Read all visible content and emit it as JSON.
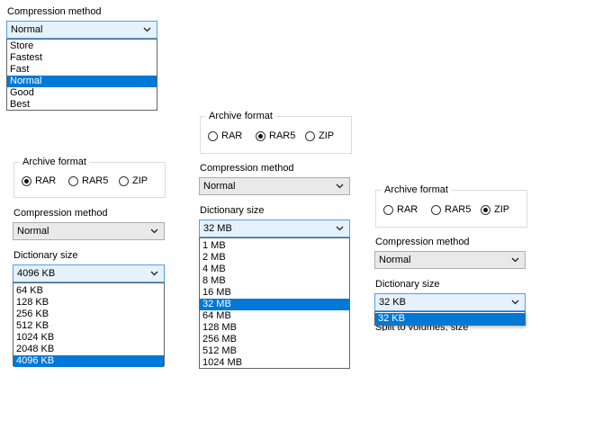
{
  "panel_a": {
    "compression_label": "Compression method",
    "compression_value": "Normal",
    "compression_options": [
      "Store",
      "Fastest",
      "Fast",
      "Normal",
      "Good",
      "Best"
    ],
    "compression_selected_index": 3
  },
  "panel_b": {
    "archive_format_label": "Archive format",
    "formats": [
      "RAR",
      "RAR5",
      "ZIP"
    ],
    "selected_format": "RAR",
    "compression_label": "Compression method",
    "compression_value": "Normal",
    "dictionary_label": "Dictionary size",
    "dictionary_value": "4096 KB",
    "dictionary_options": [
      "64 KB",
      "128 KB",
      "256 KB",
      "512 KB",
      "1024 KB",
      "2048 KB",
      "4096 KB"
    ],
    "dictionary_selected_index": 6
  },
  "panel_c": {
    "archive_format_label": "Archive format",
    "formats": [
      "RAR",
      "RAR5",
      "ZIP"
    ],
    "selected_format": "RAR5",
    "compression_label": "Compression method",
    "compression_value": "Normal",
    "dictionary_label": "Dictionary size",
    "dictionary_value": "32 MB",
    "dictionary_options": [
      "1 MB",
      "2 MB",
      "4 MB",
      "8 MB",
      "16 MB",
      "32 MB",
      "64 MB",
      "128 MB",
      "256 MB",
      "512 MB",
      "1024 MB"
    ],
    "dictionary_selected_index": 5
  },
  "panel_d": {
    "archive_format_label": "Archive format",
    "formats": [
      "RAR",
      "RAR5",
      "ZIP"
    ],
    "selected_format": "ZIP",
    "compression_label": "Compression method",
    "compression_value": "Normal",
    "dictionary_label": "Dictionary size",
    "dictionary_value": "32 KB",
    "dictionary_options": [
      "32 KB"
    ],
    "dictionary_selected_index": 0,
    "split_volumes_label": "Split to volumes, size"
  },
  "colors": {
    "selection": "#0078d7",
    "combo_focus_border": "#569de5",
    "combo_bg": "#e9e9e9"
  }
}
